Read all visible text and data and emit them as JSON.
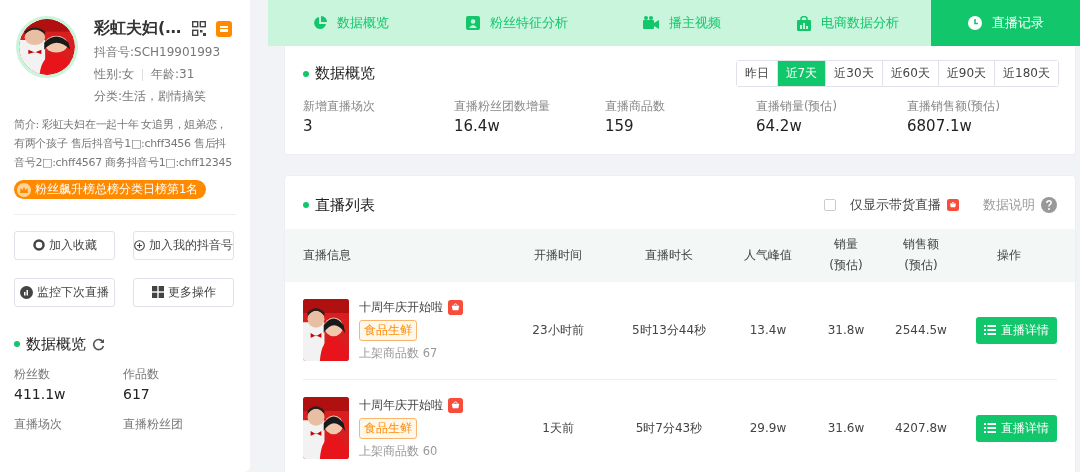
{
  "profile": {
    "name": "彩虹夫妇(…",
    "douyin_id": "抖音号:SCH19901993",
    "gender": "性别:女",
    "age": "年龄:31",
    "category": "分类:生活，剧情搞笑",
    "bio": "简介: 彩虹夫妇在一起十年 女追男，姐弟恋，有两个孩子 售后抖音号1□:chff3456 售后抖音号2□:chff4567 商务抖音号1□:chff12345",
    "rank_badge": "粉丝飙升榜总榜分类日榜第1名"
  },
  "actions": [
    {
      "label": "加入收藏",
      "kind": "collect"
    },
    {
      "label": "加入我的抖音号",
      "kind": "add"
    },
    {
      "label": "监控下次直播",
      "kind": "monitor"
    },
    {
      "label": "更多操作",
      "kind": "more"
    }
  ],
  "sidebar_overview": {
    "title": "数据概览",
    "stats": [
      {
        "label": "粉丝数",
        "value": "411.1w"
      },
      {
        "label": "作品数",
        "value": "617"
      },
      {
        "label": "直播场次"
      },
      {
        "label": "直播粉丝团"
      }
    ]
  },
  "tabs": [
    {
      "label": "数据概览",
      "kind": "pie",
      "selected": false
    },
    {
      "label": "粉丝特征分析",
      "kind": "person",
      "selected": false
    },
    {
      "label": "播主视频",
      "kind": "video",
      "selected": false
    },
    {
      "label": "电商数据分析",
      "kind": "bag",
      "selected": false
    },
    {
      "label": "直播记录",
      "kind": "clock",
      "selected": true
    }
  ],
  "overview": {
    "title": "数据概览",
    "ranges": [
      {
        "label": "昨日",
        "selected": false
      },
      {
        "label": "近7天",
        "selected": true
      },
      {
        "label": "近30天",
        "selected": false
      },
      {
        "label": "近60天",
        "selected": false
      },
      {
        "label": "近90天",
        "selected": false
      },
      {
        "label": "近180天",
        "selected": false
      }
    ],
    "metrics": [
      {
        "label": "新增直播场次",
        "value": "3"
      },
      {
        "label": "直播粉丝团数增量",
        "value": "16.4w"
      },
      {
        "label": "直播商品数",
        "value": "159"
      },
      {
        "label": "直播销量(预估)",
        "value": "64.2w"
      },
      {
        "label": "直播销售额(预估)",
        "value": "6807.1w"
      }
    ]
  },
  "live_list": {
    "title": "直播列表",
    "filter": {
      "label": "仅显示带货直播",
      "checked": false
    },
    "help": "数据说明",
    "columns": [
      {
        "label": "直播信息"
      },
      {
        "label": "开播时间"
      },
      {
        "label": "直播时长"
      },
      {
        "label": "人气峰值"
      },
      {
        "label": "销量",
        "note": "(预估)"
      },
      {
        "label": "销售额",
        "note": "(预估)"
      },
      {
        "label": "操作"
      }
    ],
    "rows": [
      {
        "title": "十周年庆开始啦",
        "tag": "食品生鲜",
        "products": "上架商品数 67",
        "start": "23小时前",
        "duration": "5时13分44秒",
        "peak": "13.4w",
        "sales": "31.8w",
        "revenue": "2544.5w",
        "action": "直播详情"
      },
      {
        "title": "十周年庆开始啦",
        "tag": "食品生鲜",
        "products": "上架商品数 60",
        "start": "1天前",
        "duration": "5时7分43秒",
        "peak": "29.9w",
        "sales": "31.6w",
        "revenue": "4207.8w",
        "action": "直播详情"
      }
    ]
  }
}
